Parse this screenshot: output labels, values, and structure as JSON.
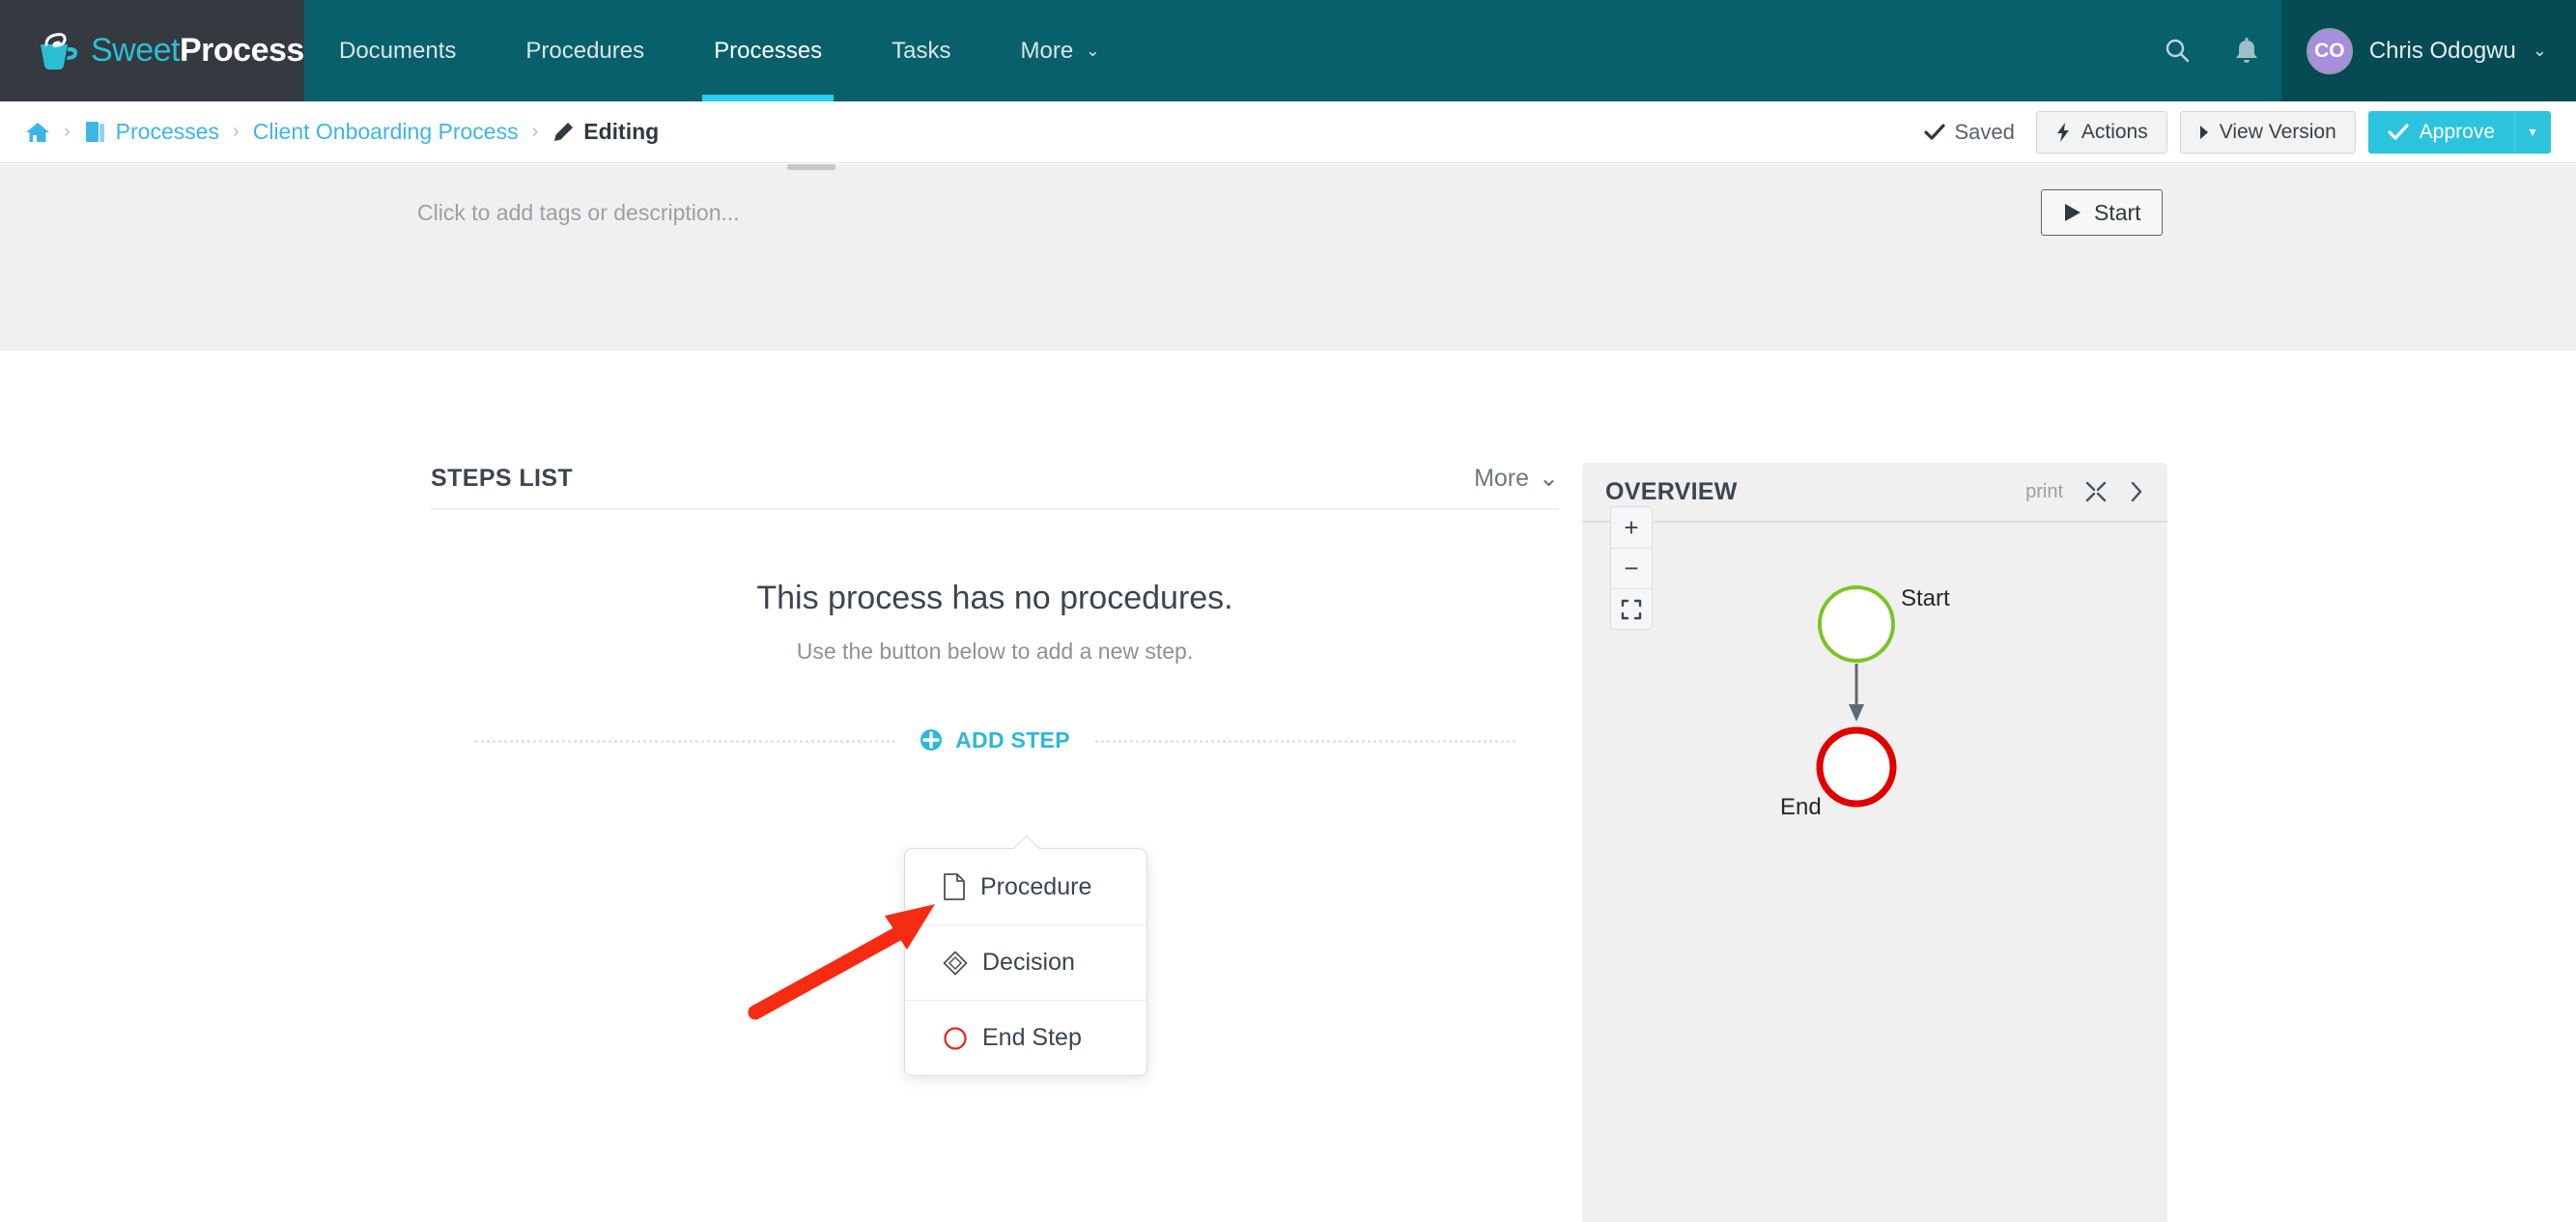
{
  "brand": {
    "name_part1": "Sweet",
    "name_part2": "Process",
    "logo_icon": "coffee-cup-icon",
    "logo_bg": "#343a40",
    "nav_bg": "#08606b",
    "accent": "#28cdf0"
  },
  "topnav": {
    "items": [
      {
        "label": "Documents",
        "active": false
      },
      {
        "label": "Procedures",
        "active": false
      },
      {
        "label": "Processes",
        "active": true
      },
      {
        "label": "Tasks",
        "active": false
      },
      {
        "label": "More",
        "active": false,
        "caret": "⌄"
      }
    ],
    "search_icon": "search-icon",
    "bell_icon": "bell-icon",
    "user": {
      "initials": "CO",
      "name": "Chris Odogwu",
      "caret": "⌄",
      "avatar_color": "#a98ede"
    }
  },
  "breadcrumb": {
    "home_icon": "home-icon",
    "sep": "›",
    "items": [
      {
        "label": "Processes",
        "icon": "book-icon",
        "link": true
      },
      {
        "label": "Client Onboarding Process",
        "icon": "",
        "link": true
      },
      {
        "label": "Editing",
        "icon": "pencil-icon",
        "link": false
      }
    ]
  },
  "page_actions": {
    "saved_label": "Saved",
    "saved_icon": "check-icon",
    "actions_label": "Actions",
    "actions_icon": "bolt-icon",
    "view_version_label": "View Version",
    "view_version_icon": "caret-right-icon",
    "approve_label": "Approve",
    "approve_icon": "check-icon",
    "approve_caret": "▾",
    "approve_color": "#2cc3dd"
  },
  "process_header": {
    "tags_placeholder": "Click to add tags or description...",
    "start_label": "Start",
    "start_icon": "play-icon"
  },
  "steps_list": {
    "title": "STEPS LIST",
    "more_label": "More",
    "more_caret": "⌄",
    "empty_title": "This process has no procedures.",
    "empty_subtitle": "Use the button below to add a new step.",
    "add_step_label": "ADD STEP",
    "add_step_icon": "plus-circle-icon"
  },
  "step_menu": {
    "items": [
      {
        "label": "Procedure",
        "icon": "document-icon"
      },
      {
        "label": "Decision",
        "icon": "diamond-icon"
      },
      {
        "label": "End Step",
        "icon": "red-circle-icon"
      }
    ]
  },
  "annotation": {
    "arrow_icon": "red-pointer-arrow",
    "arrow_color": "#f62b14",
    "points_to": "Procedure"
  },
  "overview": {
    "title": "OVERVIEW",
    "print_label": "print",
    "expand_icon": "expand-icon",
    "collapse_icon": "chevron-right-icon",
    "zoom_in": "+",
    "zoom_out": "−",
    "fit_icon": "fit-screen-icon",
    "diagram": {
      "nodes": [
        {
          "id": "start",
          "label": "Start",
          "shape": "circle",
          "stroke": "#7ac523",
          "label_position": "right"
        },
        {
          "id": "end",
          "label": "End",
          "shape": "circle",
          "stroke": "#e00000",
          "label_position": "below"
        }
      ],
      "edges": [
        {
          "from": "start",
          "to": "end",
          "style": "arrow"
        }
      ]
    }
  }
}
